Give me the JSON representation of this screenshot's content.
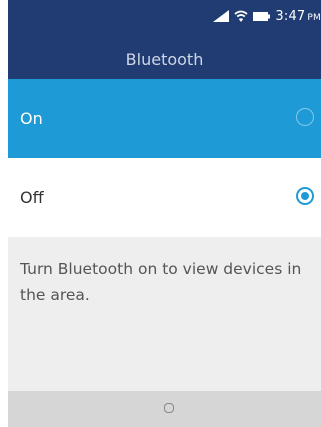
{
  "status": {
    "time": "3:47",
    "ampm": "PM",
    "icons": [
      "signal-icon",
      "wifi-icon",
      "battery-icon"
    ]
  },
  "header": {
    "title": "Bluetooth"
  },
  "options": [
    {
      "label": "On",
      "selected": false,
      "focused": true
    },
    {
      "label": "Off",
      "selected": true,
      "focused": false
    }
  ],
  "info": {
    "text": "Turn Bluetooth on to view devices in the area."
  },
  "softkeys": {
    "center_icon": "select-circle-icon"
  },
  "colors": {
    "header": "#213c73",
    "accent": "#1e9bd6",
    "info_bg": "#eeeeee",
    "softkey_bg": "#d6d6d6"
  }
}
